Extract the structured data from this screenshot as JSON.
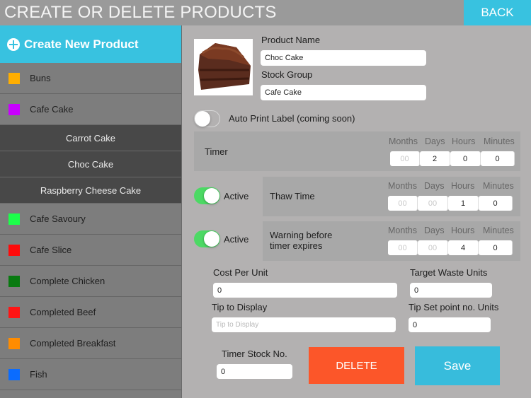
{
  "header": {
    "title": "CREATE OR DELETE PRODUCTS",
    "back_label": "BACK"
  },
  "sidebar": {
    "create_label": "Create New Product",
    "groups_top": [
      {
        "label": "Buns",
        "color": "#ffae00"
      },
      {
        "label": "Cafe Cake",
        "color": "#c800ff"
      }
    ],
    "sub_items": [
      "Carrot Cake",
      "Choc Cake",
      "Raspberry Cheese Cake"
    ],
    "groups_bottom": [
      {
        "label": "Cafe Savoury",
        "color": "#1cff4a"
      },
      {
        "label": "Cafe Slice",
        "color": "#ff0a0a"
      },
      {
        "label": "Complete Chicken",
        "color": "#087a10"
      },
      {
        "label": "Completed Beef",
        "color": "#ff1414"
      },
      {
        "label": "Completed Breakfast",
        "color": "#ff8c00"
      },
      {
        "label": "Fish",
        "color": "#0a6cff"
      }
    ]
  },
  "product": {
    "image": "chocolate-cake-slice",
    "name_label": "Product Name",
    "name_value": "Choc Cake",
    "group_label": "Stock Group",
    "group_value": "Cafe Cake",
    "auto_print_label": "Auto Print Label (coming soon)",
    "auto_print_on": false
  },
  "units": [
    "Months",
    "Days",
    "Hours",
    "Minutes"
  ],
  "timer": {
    "label": "Timer",
    "values": [
      "00",
      "2",
      "0",
      "0"
    ]
  },
  "thaw": {
    "active_label": "Active",
    "active": true,
    "label": "Thaw Time",
    "values": [
      "00",
      "00",
      "1",
      "0"
    ]
  },
  "warning": {
    "active_label": "Active",
    "active": true,
    "label_line1": "Warning  before",
    "label_line2": "timer expires",
    "values": [
      "00",
      "00",
      "4",
      "0"
    ]
  },
  "fields": {
    "cost_label": "Cost Per Unit",
    "cost_value": "0",
    "target_waste_label": "Target Waste Units",
    "target_waste_value": "0",
    "tip_label": "Tip to Display",
    "tip_placeholder": "Tip to Display",
    "tip_setpoint_label": "Tip Set point no. Units",
    "tip_setpoint_value": "0",
    "timer_stock_label": "Timer Stock No.",
    "timer_stock_value": "0"
  },
  "actions": {
    "delete_label": "DELETE",
    "save_label": "Save"
  }
}
